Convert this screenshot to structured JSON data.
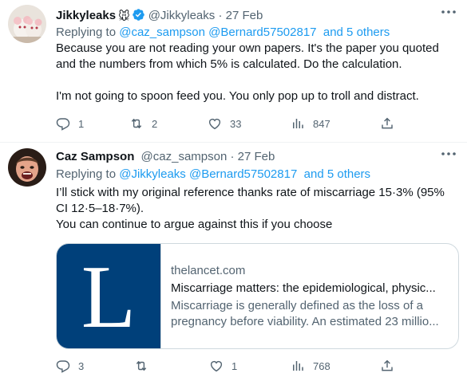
{
  "colors": {
    "link": "#1d9bf0",
    "secondary_text": "#536471",
    "primary_text": "#0f1419",
    "verified_badge": "#1d9bf0",
    "card_thumb_bg": "#00407a"
  },
  "tweets": [
    {
      "name": "Jikkyleaks",
      "name_emoji": "🐭",
      "verified": true,
      "handle": "@Jikkyleaks",
      "dot": "·",
      "date": "27 Feb",
      "replying_prefix": "Replying to",
      "replying_to": [
        "@caz_sampson",
        "@Bernard57502817"
      ],
      "replying_others": "and 5 others",
      "text_lines": [
        "Because you are not reading your own papers. It's the paper you quoted",
        "and the numbers from which 5% is calculated. Do the calculation.",
        "",
        "I'm not going to spoon feed you. You only pop up to troll and distract."
      ],
      "actions": {
        "replies": "1",
        "retweets": "2",
        "likes": "33",
        "views": "847"
      },
      "icons": [
        "more-icon",
        "reply-icon",
        "retweet-icon",
        "like-icon",
        "views-icon",
        "share-icon",
        "verified-badge-icon"
      ]
    },
    {
      "name": "Caz Sampson",
      "handle": "@caz_sampson",
      "dot": "·",
      "date": "27 Feb",
      "replying_prefix": "Replying to",
      "replying_to": [
        "@Jikkyleaks",
        "@Bernard57502817"
      ],
      "replying_others": "and 5 others",
      "text_lines": [
        "I’ll stick with my original reference thanks rate of miscarriage 15·3% (95%",
        "CI 12·5–18·7%).",
        "You can continue to argue against this if you choose"
      ],
      "card": {
        "logo_letter": "L",
        "domain": "thelancet.com",
        "title": "Miscarriage matters: the epidemiological, physic...",
        "description_lines": [
          "Miscarriage is generally defined as the loss of a",
          "pregnancy before viability. An estimated 23 millio..."
        ]
      },
      "actions": {
        "replies": "3",
        "retweets": "",
        "likes": "1",
        "views": "768"
      },
      "icons": [
        "more-icon",
        "reply-icon",
        "retweet-icon",
        "like-icon",
        "views-icon",
        "share-icon"
      ]
    }
  ]
}
